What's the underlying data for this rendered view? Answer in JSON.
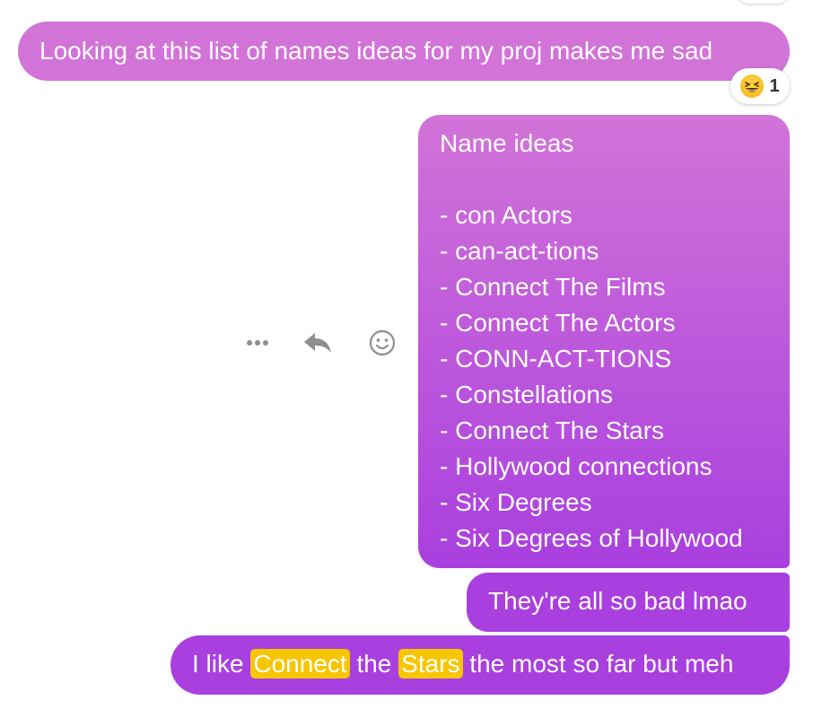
{
  "messages": [
    {
      "text": "Looking at this list of names ideas for my proj makes me sad",
      "reaction": {
        "icon": "grinning-squinting-face-icon",
        "count": "1"
      }
    },
    {
      "lines": [
        "Name ideas",
        "",
        "- con Actors",
        "- can-act-tions",
        "- Connect The Films",
        "- Connect The Actors",
        "- CONN-ACT-TIONS",
        "- Constellations",
        "- Connect The Stars",
        "- Hollywood connections",
        "- Six Degrees",
        "- Six Degrees of Hollywood"
      ]
    },
    {
      "text": "They're all so bad lmao"
    },
    {
      "segments": {
        "a": "I like",
        "h1": "Connect",
        "b": "the",
        "h2": "Stars",
        "c": "the most so far but meh"
      }
    }
  ],
  "message_actions": {
    "more_icon": "more-dots-icon",
    "reply_icon": "reply-arrow-icon",
    "react_icon": "smiley-icon"
  },
  "colors": {
    "bubble_top": "#d273d8",
    "bubble_bottom": "#a93fdf",
    "highlight": "#f7c600",
    "icon_gray": "#8e8e93"
  }
}
